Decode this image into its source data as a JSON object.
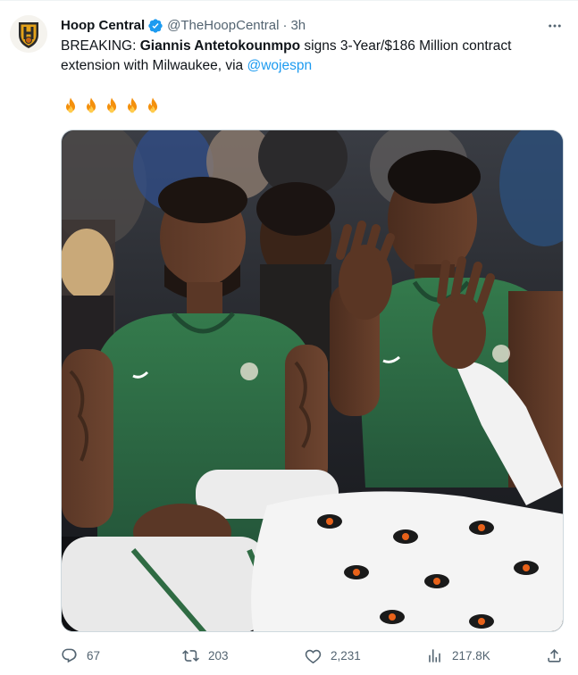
{
  "tweet": {
    "author": {
      "display_name": "Hoop Central",
      "handle": "@TheHoopCentral",
      "separator": "·",
      "time": "3h",
      "verified": true
    },
    "text": {
      "prefix": "BREAKING: ",
      "bold": "Giannis Antetokounmpo",
      "middle": " signs 3-Year/$186 Million contract extension with Milwaukee, via ",
      "mention": "@wojespn"
    },
    "emoji": [
      "🔥",
      "🔥",
      "🔥",
      "🔥",
      "🔥"
    ],
    "media": {
      "kind": "photo"
    },
    "actions": {
      "replies": "67",
      "reposts": "203",
      "likes": "2,231",
      "views": "217.8K"
    }
  },
  "colors": {
    "text_primary": "#0f1419",
    "text_secondary": "#536471",
    "link": "#1d9bf0",
    "verified": "#1d9bf0",
    "border": "#cfd9de",
    "jersey_green": "#2f6b43"
  },
  "icons": [
    "avatar-logo",
    "verified-badge-icon",
    "more-icon",
    "reply-icon",
    "repost-icon",
    "like-icon",
    "views-icon",
    "share-icon"
  ]
}
